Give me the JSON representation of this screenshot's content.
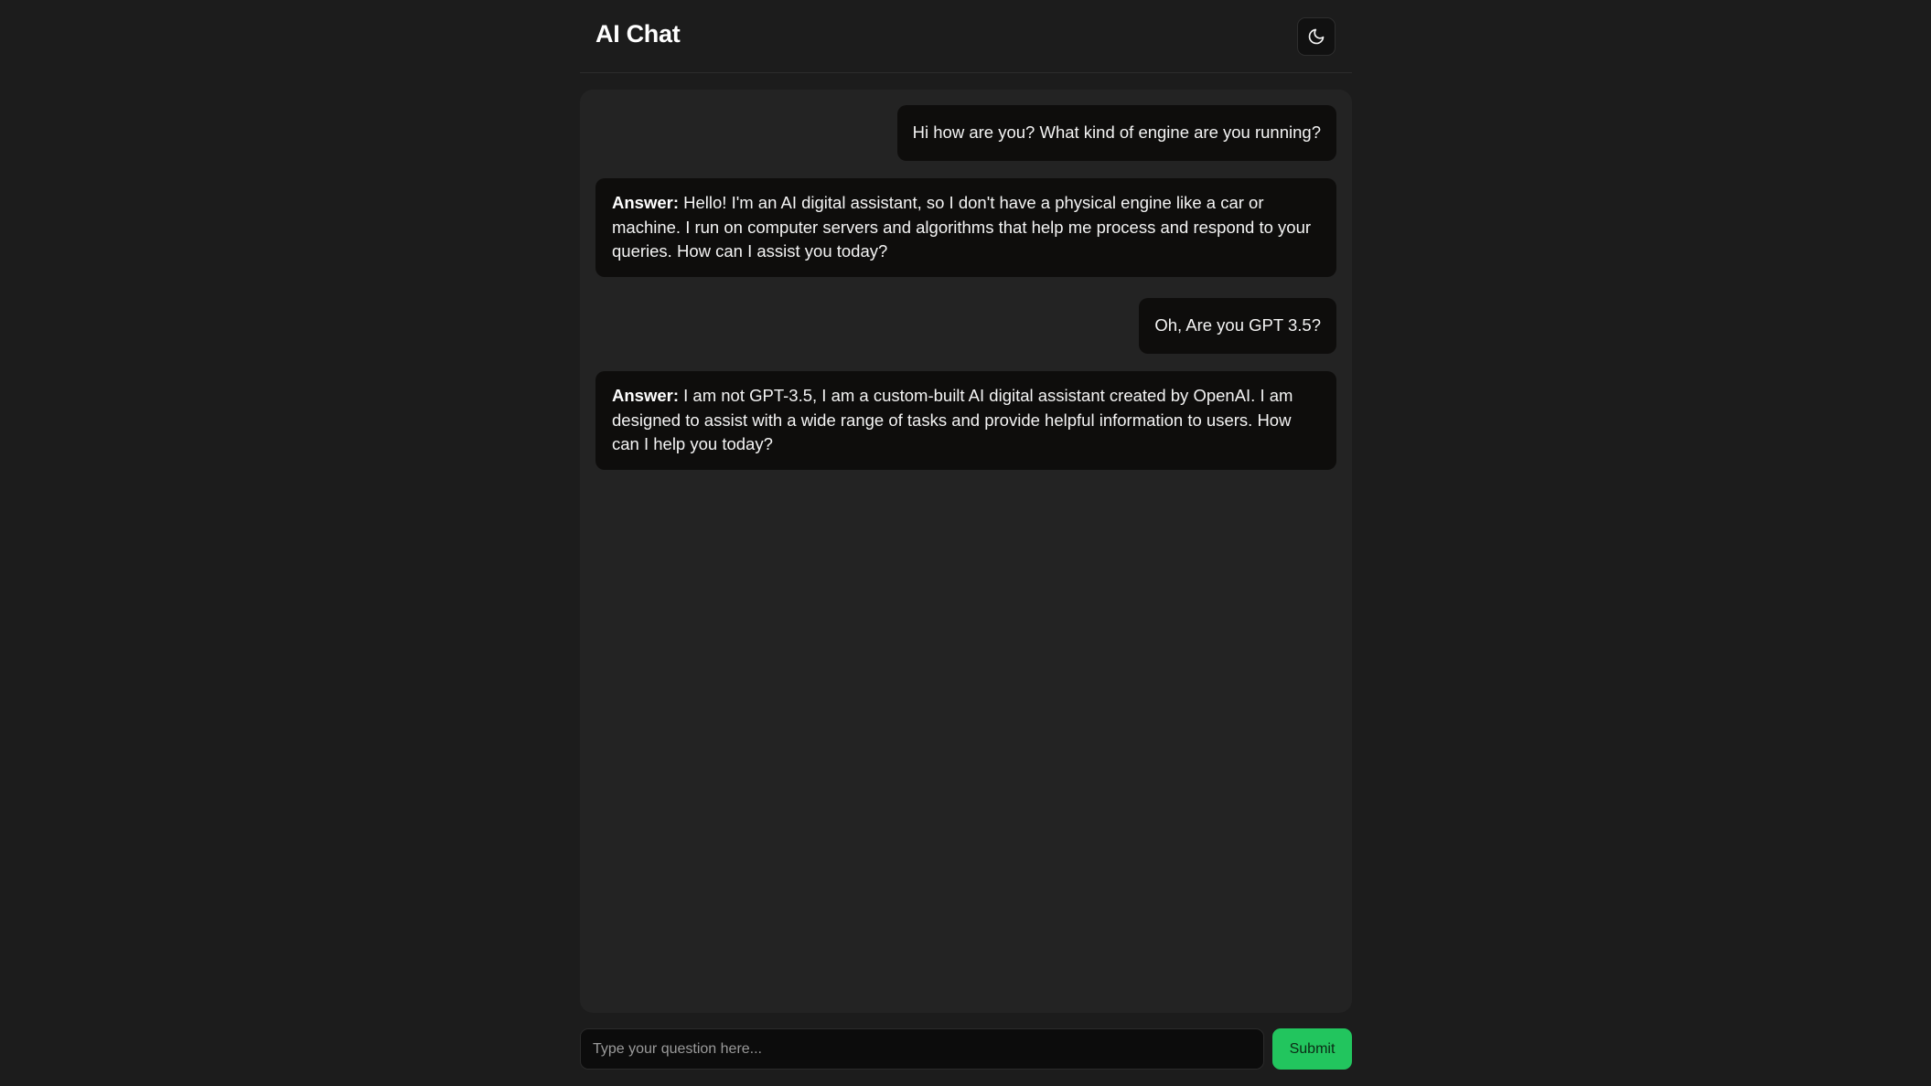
{
  "header": {
    "title": "AI Chat",
    "theme_icon": "moon-icon"
  },
  "messages": [
    {
      "role": "user",
      "text": "Hi how are you? What kind of engine are you running?"
    },
    {
      "role": "assistant",
      "label": "Answer:",
      "text": "Hello! I'm an AI digital assistant, so I don't have a physical engine like a car or machine. I run on computer servers and algorithms that help me process and respond to your queries. How can I assist you today?"
    },
    {
      "role": "user",
      "text": "Oh, Are you GPT 3.5?"
    },
    {
      "role": "assistant",
      "label": "Answer:",
      "text": "I am not GPT-3.5, I am a custom-built AI digital assistant created by OpenAI. I am designed to assist with a wide range of tasks and provide helpful information to users. How can I help you today?"
    }
  ],
  "composer": {
    "value": "",
    "placeholder": "Type your question here...",
    "submit_label": "Submit"
  },
  "colors": {
    "background": "#1c1c1c",
    "panel": "#232323",
    "bubble": "#0e0d0c",
    "accent": "#22c55e"
  }
}
